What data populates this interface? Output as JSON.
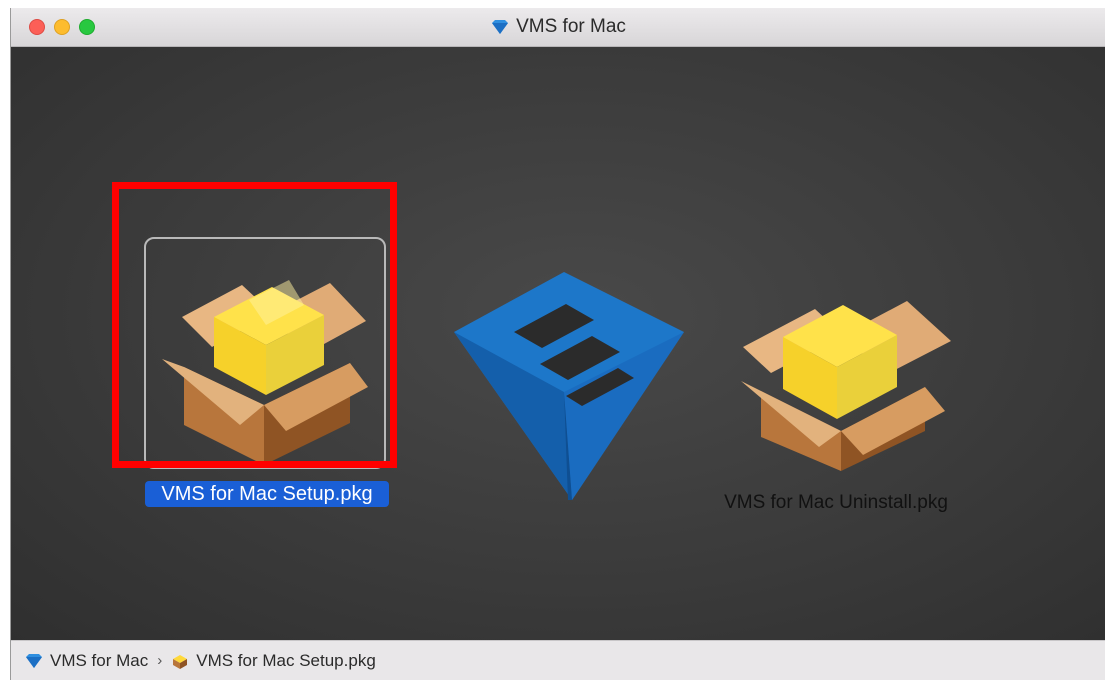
{
  "window": {
    "title": "VMS for Mac",
    "title_icon": "vms-diamond-icon"
  },
  "files": [
    {
      "name": "VMS for Mac Setup.pkg",
      "icon": "package-icon",
      "selected": true,
      "highlighted": true
    },
    {
      "name": "VMS for Mac Uninstall.pkg",
      "icon": "package-icon",
      "selected": false,
      "highlighted": false
    }
  ],
  "background_logo": "vms-logo",
  "path_bar": {
    "items": [
      {
        "label": "VMS for Mac",
        "icon": "vms-diamond-icon"
      },
      {
        "label": "VMS for Mac Setup.pkg",
        "icon": "package-icon"
      }
    ],
    "separator": "›"
  },
  "colors": {
    "highlight": "#ff0000",
    "selection": "#1a5fd6",
    "logo": "#1d77c9"
  }
}
